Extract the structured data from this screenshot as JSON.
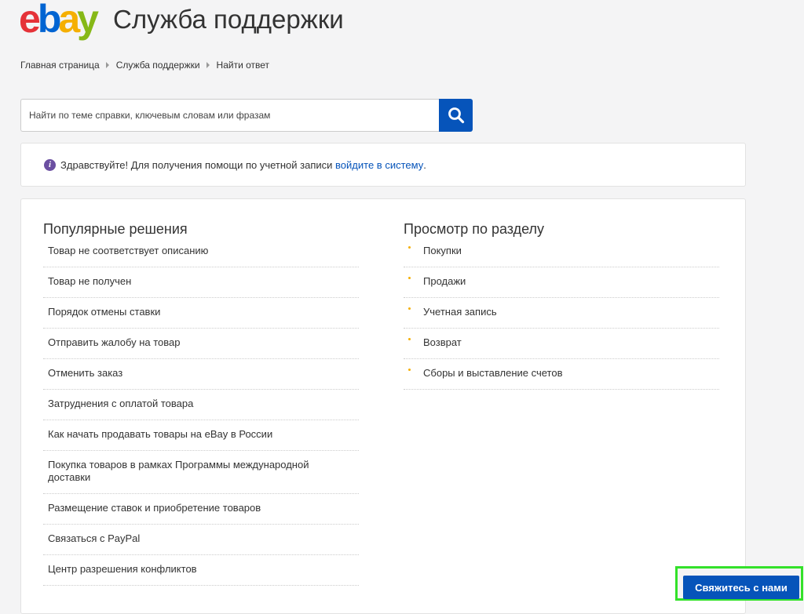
{
  "header": {
    "logo": {
      "l1": "e",
      "l2": "b",
      "l3": "a",
      "l4": "y"
    },
    "title": "Служба поддержки"
  },
  "breadcrumb": [
    "Главная страница",
    "Служба поддержки",
    "Найти ответ"
  ],
  "search": {
    "placeholder": "Найти по теме справки, ключевым словам или фразам",
    "icon": "search-icon"
  },
  "notice": {
    "text": "Здравствуйте! Для получения помощи по учетной записи ",
    "link": "войдите в систему",
    "suffix": "."
  },
  "popular": {
    "title": "Популярные решения",
    "items": [
      "Товар не соответствует описанию",
      "Товар не получен",
      "Порядок отмены ставки",
      "Отправить жалобу на товар",
      "Отменить заказ",
      "Затруднения с оплатой товара",
      "Как начать продавать товары на eBay в России",
      "Покупка товаров в рамках Программы международной доставки",
      "Размещение ставок и приобретение товаров",
      "Связаться с PayPal",
      "Центр разрешения конфликтов"
    ]
  },
  "browse": {
    "title": "Просмотр по разделу",
    "items": [
      "Покупки",
      "Продажи",
      "Учетная запись",
      "Возврат",
      "Сборы и выставление счетов"
    ]
  },
  "contact": {
    "label": "Свяжитесь с нами"
  },
  "colors": {
    "accent": "#0654ba",
    "highlight": "#33e12a",
    "info": "#6b4fa1"
  }
}
